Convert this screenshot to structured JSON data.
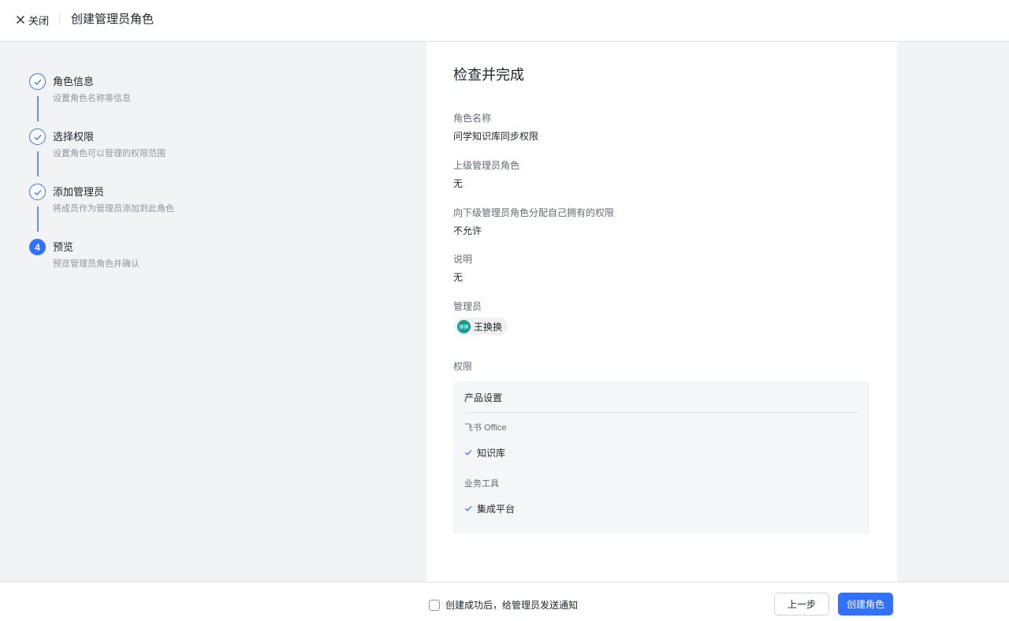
{
  "header": {
    "close_label": "关闭",
    "title": "创建管理员角色"
  },
  "steps": [
    {
      "title": "角色信息",
      "desc": "设置角色名称等信息",
      "status": "done"
    },
    {
      "title": "选择权限",
      "desc": "设置角色可以管理的权限范围",
      "status": "done"
    },
    {
      "title": "添加管理员",
      "desc": "将成员作为管理员添加到此角色",
      "status": "done"
    },
    {
      "title": "预览",
      "desc": "预览管理员角色并确认",
      "status": "active",
      "number": "4"
    }
  ],
  "review": {
    "heading": "检查并完成",
    "role_name_label": "角色名称",
    "role_name_value": "问学知识库同步权限",
    "parent_role_label": "上级管理员角色",
    "parent_role_value": "无",
    "delegate_label": "向下级管理员角色分配自己拥有的权限",
    "delegate_value": "不允许",
    "description_label": "说明",
    "description_value": "无",
    "admins_label": "管理员",
    "admin": {
      "avatar_text": "换换",
      "name": "王换换"
    },
    "permissions_label": "权限",
    "permissions": {
      "section_title": "产品设置",
      "groups": [
        {
          "name": "飞书 Office",
          "items": [
            "知识库"
          ]
        },
        {
          "name": "业务工具",
          "items": [
            "集成平台"
          ]
        }
      ]
    }
  },
  "footer": {
    "notify_label": "创建成功后，给管理员发送通知",
    "notify_checked": false,
    "prev_label": "上一步",
    "create_label": "创建角色"
  },
  "colors": {
    "accent": "#3370ff",
    "background": "#f2f3f5",
    "avatar": "#1c9b8c"
  }
}
